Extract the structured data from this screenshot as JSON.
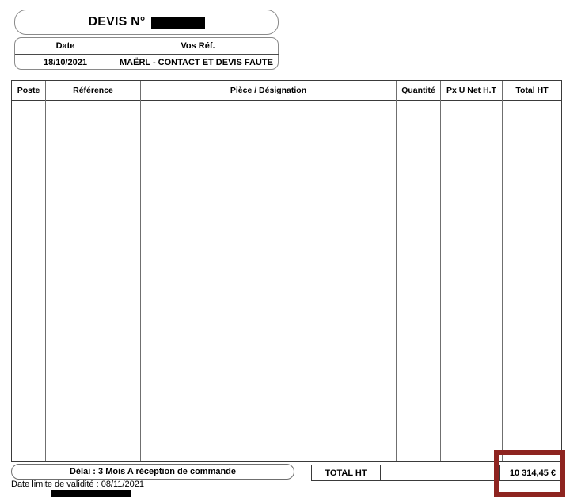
{
  "document": {
    "type": "quote",
    "title_label": "DEVIS N°",
    "number_redacted": true
  },
  "ref_table": {
    "headers": {
      "date": "Date",
      "your_ref": "Vos Réf."
    },
    "values": {
      "date": "18/10/2021",
      "your_ref": "MAËRL - CONTACT ET DEVIS FAUTE"
    }
  },
  "line_items_table": {
    "columns": [
      {
        "key": "poste",
        "label": "Poste"
      },
      {
        "key": "reference",
        "label": "Référence"
      },
      {
        "key": "designation",
        "label": "Pièce / Désignation"
      },
      {
        "key": "quantite",
        "label": "Quantité"
      },
      {
        "key": "px_u_net_ht",
        "label": "Px U Net H.T"
      },
      {
        "key": "total_ht",
        "label": "Total HT"
      }
    ],
    "rows": []
  },
  "footer": {
    "delay_note": "Délai : 3 Mois A réception de commande",
    "validity_note": "Date limite de validité : 08/11/2021",
    "redacted_bar": true
  },
  "totals": {
    "label": "TOTAL HT",
    "middle_cell": "",
    "amount": "10 314,45 €"
  },
  "annotation": {
    "highlight_color": "#8E2420",
    "target": "total-ht-amount"
  }
}
